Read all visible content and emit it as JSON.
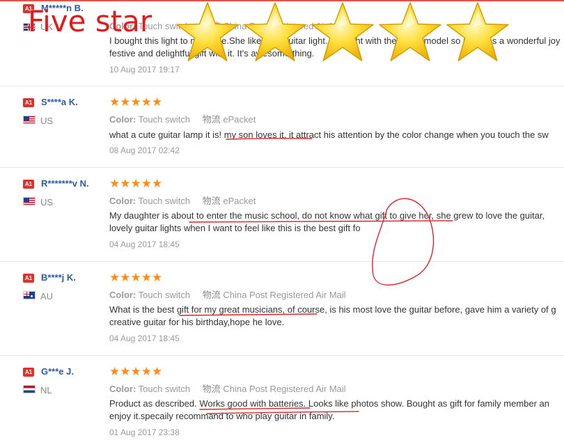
{
  "overlay": {
    "title": "Five star",
    "stars_count": 5
  },
  "labels": {
    "color_label": "Color:",
    "ship_label": "物流"
  },
  "reviews": [
    {
      "badge": "A1",
      "name": "M*****n B.",
      "country": "UK",
      "rating": 5,
      "color": "Touch switch",
      "shipping": "China Post Registered Air Mail",
      "text_line1": "I bought this light to my niece.She likes the guitar light. I bought with the same model so it makes a wonderful joy",
      "text_line2": "festive and delightful gift with it. It's awesome thing.",
      "date": "10 Aug 2017 19:17"
    },
    {
      "badge": "A1",
      "name": "S****a K.",
      "country": "US",
      "rating": 5,
      "color": "Touch switch",
      "shipping": "ePacket",
      "text_line1": "what a cute guitar lamp it is! my son loves it, it attract his attention by the color change when you touch the sw",
      "text_line2": "",
      "date": "08 Aug 2017 02:42"
    },
    {
      "badge": "A1",
      "name": "R*******v N.",
      "country": "US",
      "rating": 5,
      "color": "Touch switch",
      "shipping": "ePacket",
      "text_line1": "My daughter is about to enter the music school, do not know what gift to give her, she grew to love the guitar,",
      "text_line2": "lovely guitar lights when I want to feel like this is the best gift fo",
      "date": "04 Aug 2017 18:45"
    },
    {
      "badge": "A1",
      "name": "B****j K.",
      "country": "AU",
      "rating": 5,
      "color": "Touch switch",
      "shipping": "China Post Registered Air Mail",
      "text_line1": "What is the best gift for my great musicians, of course, is his most love the guitar before, gave him a variety of g",
      "text_line2": "creative guitar for his birthday,hope he love.",
      "date": "04 Aug 2017 18:45"
    },
    {
      "badge": "A1",
      "name": "G***e J.",
      "country": "NL",
      "rating": 5,
      "color": "Touch switch",
      "shipping": "China Post Registered Air Mail",
      "text_line1": "Product as described. Works good with batteries. Looks like photos show. Bought as gift for family member an",
      "text_line2": "enjoy it.specaily recommand to who play guitar in family.",
      "date": "01 Aug 2017 23:38"
    }
  ],
  "colors": {
    "accent_red": "#e11b1b",
    "name_blue": "#2d5aa7",
    "star_orange": "#ff8c1a",
    "badge_red": "#d9342b"
  }
}
